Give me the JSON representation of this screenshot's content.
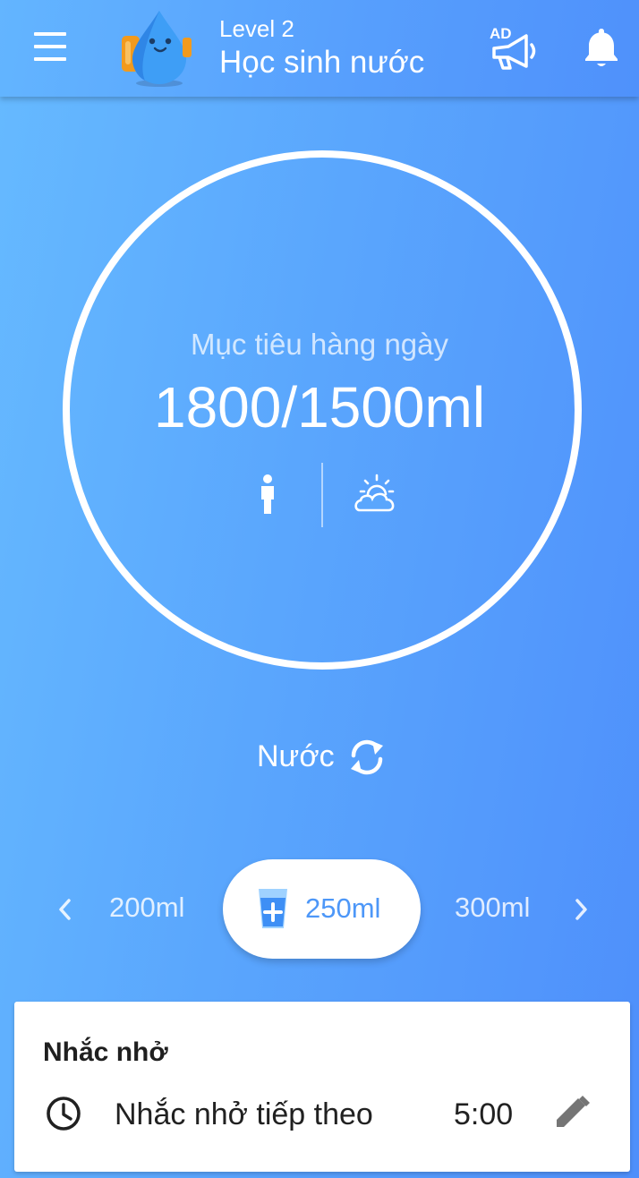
{
  "header": {
    "level": "Level 2",
    "title": "Học sinh nước",
    "icons": {
      "menu": "hamburger-menu-icon",
      "ad": "ad-megaphone-icon",
      "notifications": "bell-icon",
      "avatar": "water-drop-mascot"
    }
  },
  "goal": {
    "label": "Mục tiêu hàng ngày",
    "value": "1800/1500ml",
    "icons": {
      "profile": "person-icon",
      "weather": "sun-cloud-icon"
    }
  },
  "drink": {
    "name": "Nước",
    "switch_icon": "swap-refresh-icon"
  },
  "cup_sizes": {
    "prev": "200ml",
    "selected": "250ml",
    "next": "300ml",
    "selected_icon": "glass-plus-icon"
  },
  "reminder": {
    "title": "Nhắc nhở",
    "label": "Nhắc nhở tiếp theo",
    "time": "5:00",
    "icons": {
      "clock": "clock-icon",
      "edit": "pencil-icon"
    }
  },
  "colors": {
    "gradient_start": "#66baff",
    "gradient_end": "#4e8ffb",
    "accent_text": "#4d97f8",
    "card_bg": "#ffffff"
  }
}
